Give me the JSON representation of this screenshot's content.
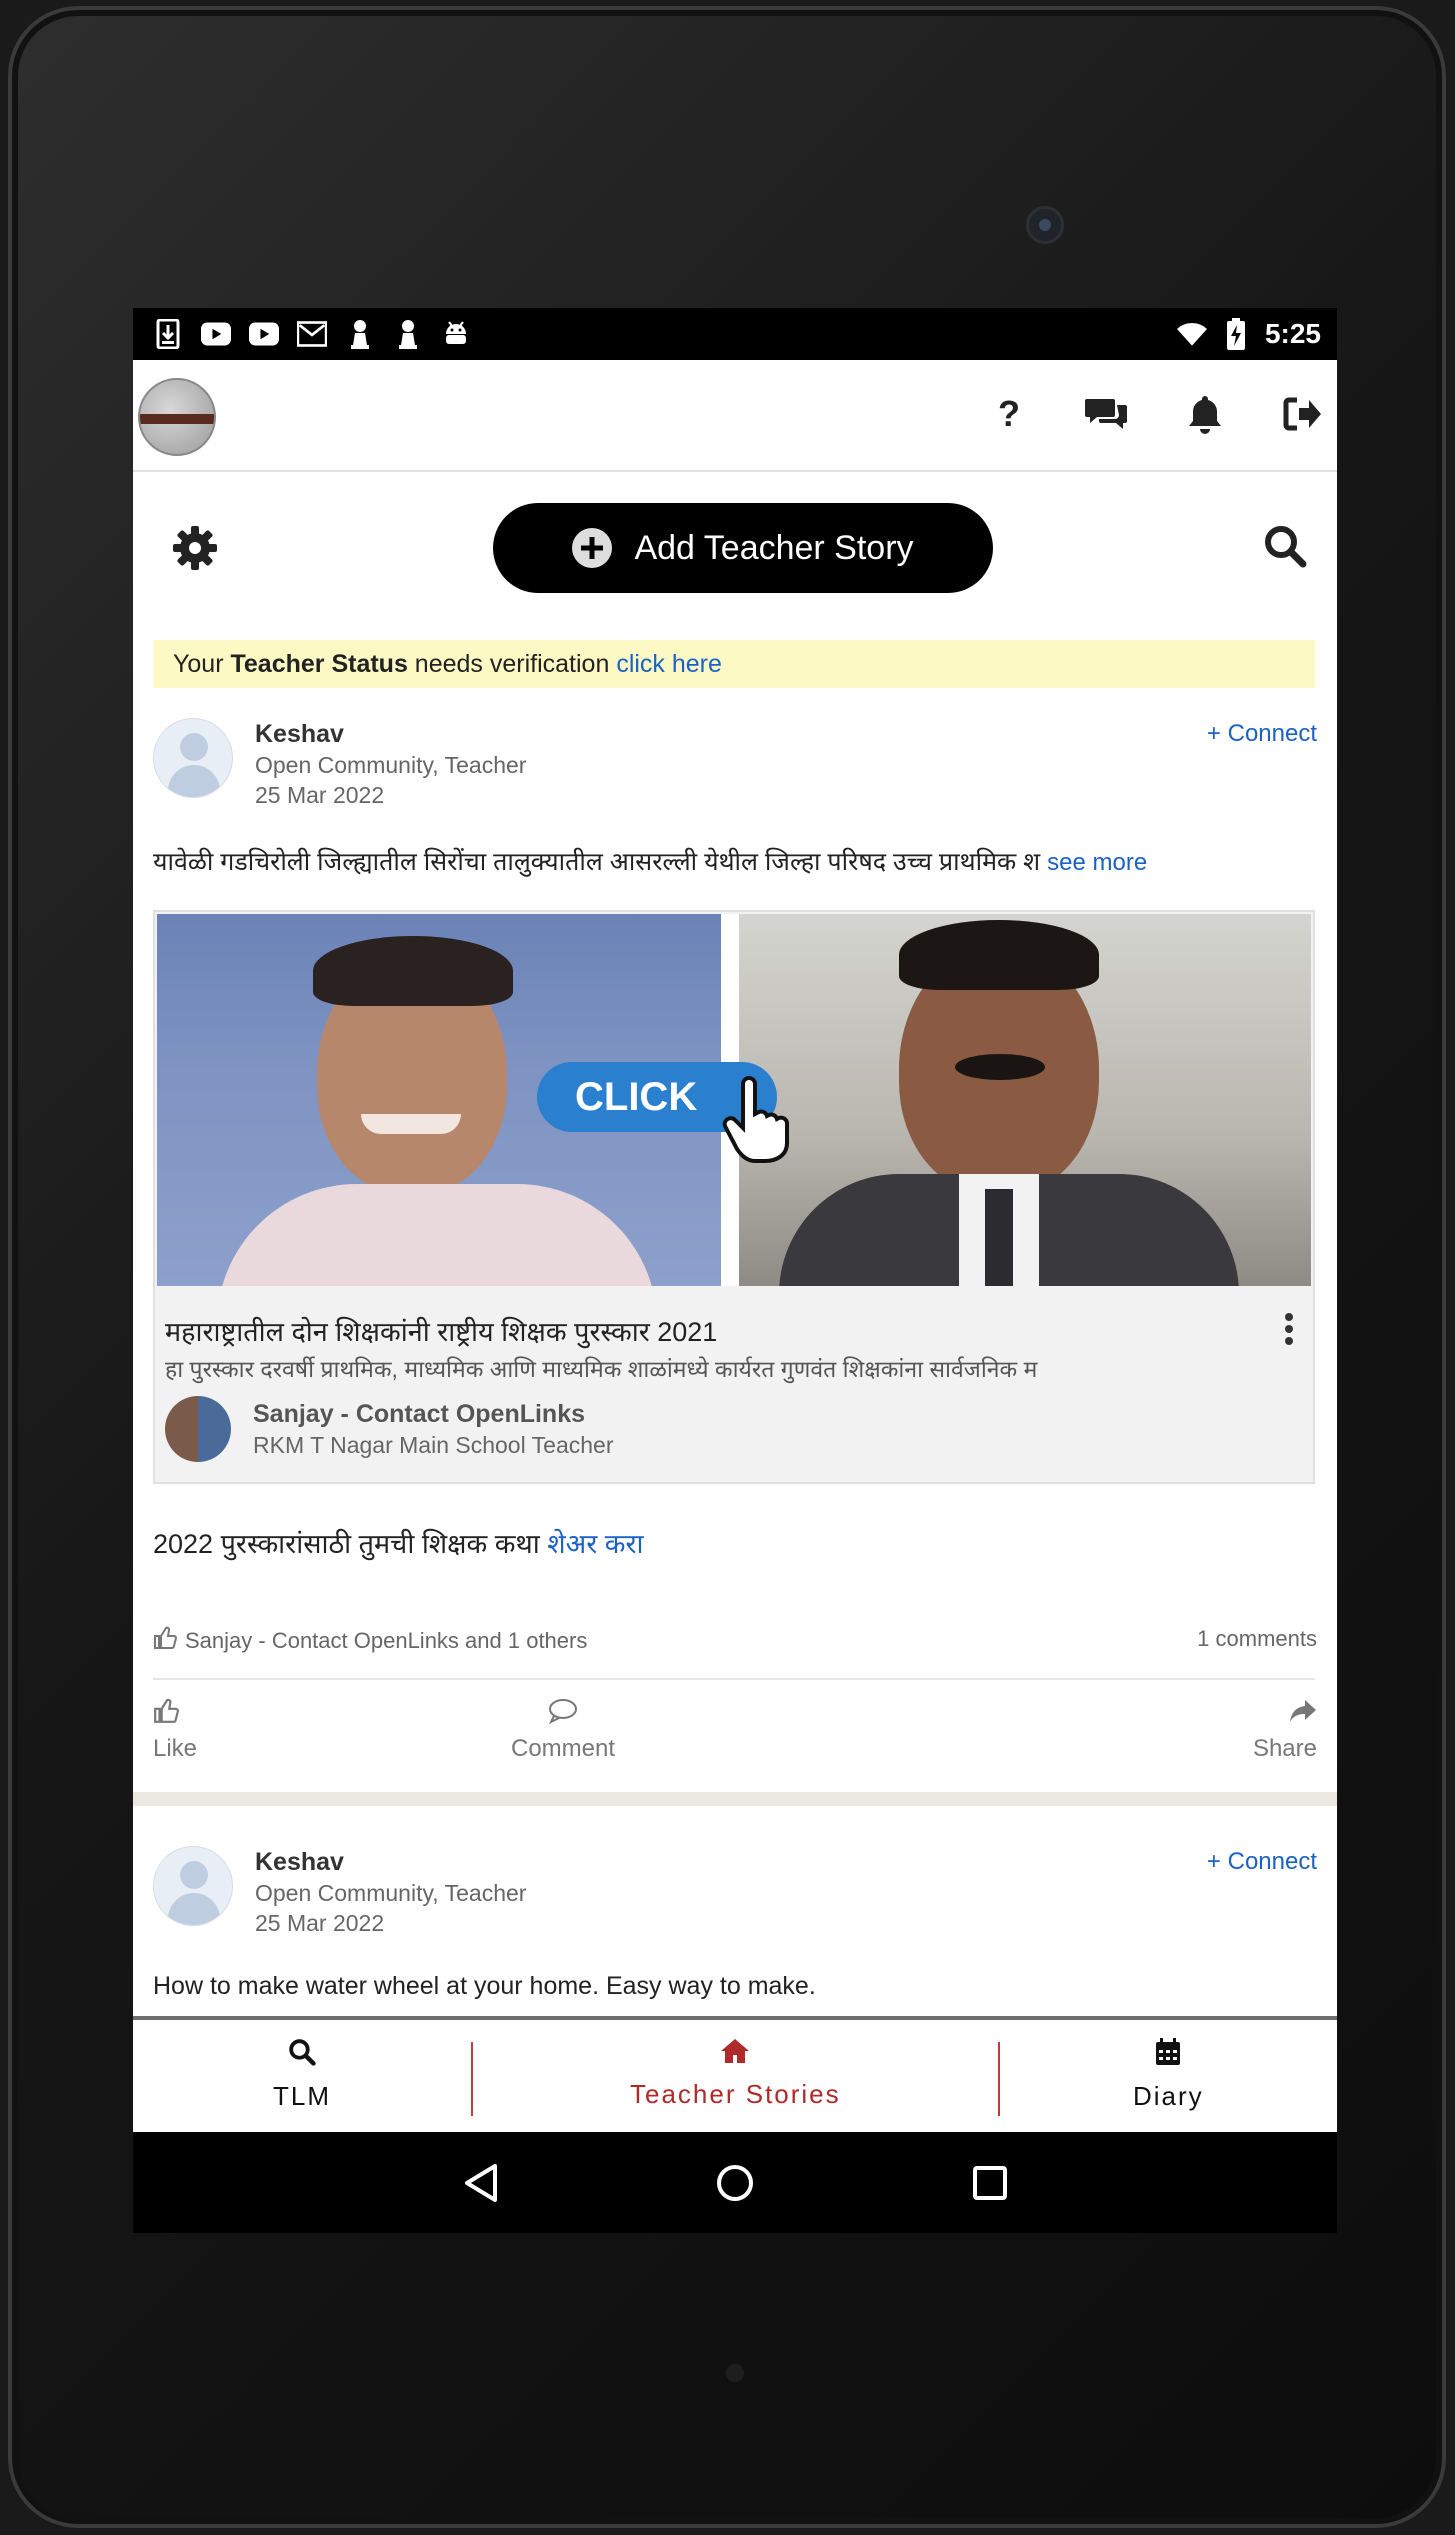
{
  "status_bar": {
    "time": "5:25",
    "notification_icons": [
      "download-icon",
      "youtube-icon",
      "youtube-icon",
      "gmail-icon",
      "pawn-icon",
      "pawn-icon",
      "android-icon"
    ],
    "status_icons": [
      "wifi-icon",
      "battery-charging-icon"
    ]
  },
  "app_bar": {
    "icons": [
      "help-icon",
      "chat-icon",
      "bell-icon",
      "logout-icon"
    ],
    "help_glyph": "?"
  },
  "toolbar": {
    "add_story_label": "Add Teacher Story"
  },
  "verification": {
    "prefix": "Your ",
    "bold": "Teacher Status",
    "middle": " needs verification ",
    "link": "click here"
  },
  "post1": {
    "author": "Keshav",
    "community": "Open Community, Teacher",
    "date": "25 Mar 2022",
    "connect_label": "+ Connect",
    "text": "यावेळी गडचिरोली जिल्ह्यातील सिरोंचा तालुक्यातील आसरल्ली येथील जिल्हा परिषद उच्च प्राथमिक श ",
    "see_more": "see more",
    "card": {
      "click_label": "CLICK",
      "title": "महाराष्ट्रातील दोन शिक्षकांनी राष्ट्रीय शिक्षक पुरस्कार 2021",
      "subtitle": "हा पुरस्कार दरवर्षी प्राथमिक, माध्यमिक आणि माध्यमिक शाळांमध्ये कार्यरत गुणवंत शिक्षकांना सार्वजनिक म",
      "shared_by": "Sanjay - Contact OpenLinks",
      "shared_by_meta": "RKM T Nagar Main School Teacher"
    },
    "share_prefix": "2022 पुरस्कारांसाठी तुमची शिक्षक कथा ",
    "share_link": "शेअर करा",
    "likes_text": "Sanjay - Contact OpenLinks and 1 others",
    "comments_text": "1 comments",
    "actions": {
      "like": "Like",
      "comment": "Comment",
      "share": "Share"
    }
  },
  "post2": {
    "author": "Keshav",
    "community": "Open Community, Teacher",
    "date": "25 Mar 2022",
    "connect_label": "+ Connect",
    "text": "How to make water wheel at your home. Easy way to make."
  },
  "bottom_nav": {
    "items": [
      {
        "label": "TLM",
        "icon": "search-icon"
      },
      {
        "label": "Teacher Stories",
        "icon": "home-icon",
        "active": true
      },
      {
        "label": "Diary",
        "icon": "calendar-icon"
      }
    ],
    "active_color": "#b02a2a"
  },
  "system_nav": [
    "back-icon",
    "home-circle-icon",
    "recents-icon"
  ]
}
